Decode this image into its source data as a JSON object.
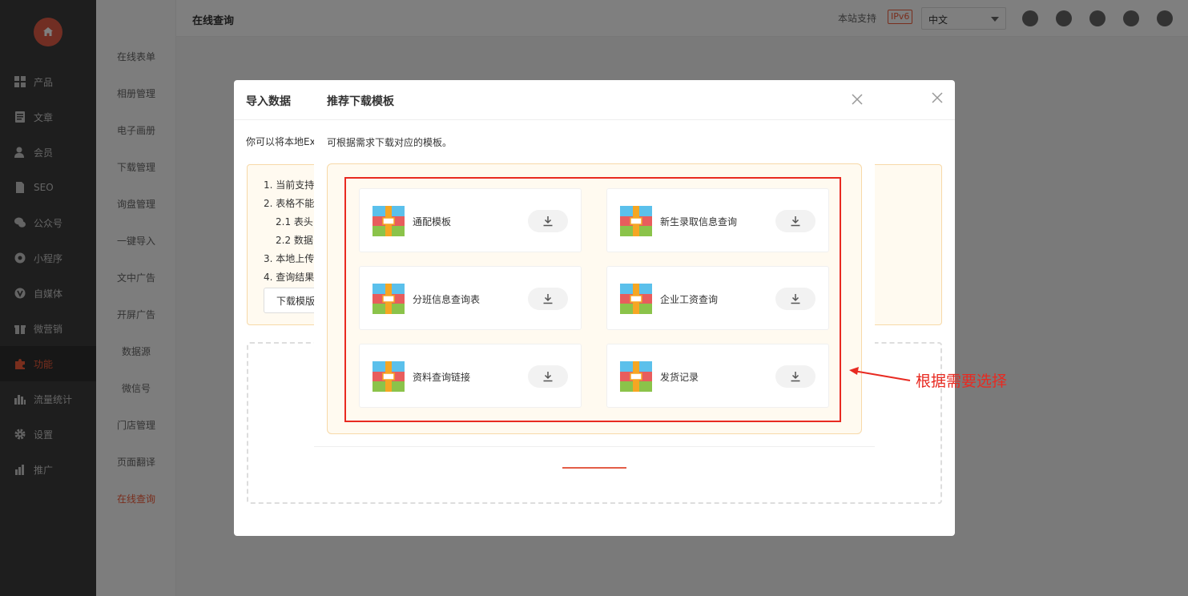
{
  "sidebar": {
    "items": [
      {
        "label": "产品",
        "icon": "grid-icon"
      },
      {
        "label": "文章",
        "icon": "document-icon"
      },
      {
        "label": "会员",
        "icon": "user-icon"
      },
      {
        "label": "SEO",
        "icon": "file-icon"
      },
      {
        "label": "公众号",
        "icon": "wechat-icon"
      },
      {
        "label": "小程序",
        "icon": "mini-program-icon"
      },
      {
        "label": "自媒体",
        "icon": "media-icon"
      },
      {
        "label": "微营销",
        "icon": "gift-icon"
      },
      {
        "label": "功能",
        "icon": "puzzle-icon",
        "active": true
      },
      {
        "label": "流量统计",
        "icon": "bar-chart-icon"
      },
      {
        "label": "设置",
        "icon": "gear-icon"
      },
      {
        "label": "推广",
        "icon": "promotion-icon"
      }
    ]
  },
  "submenu": {
    "items": [
      "在线表单",
      "相册管理",
      "电子画册",
      "下载管理",
      "询盘管理",
      "一键导入",
      "文中广告",
      "开屏广告",
      "数据源",
      "微信号",
      "门店管理",
      "页面翻译",
      "在线查询"
    ],
    "active_index": 12
  },
  "header": {
    "title": "在线查询",
    "ipv6_text": "本站支持",
    "ipv6_badge": "IPv6",
    "language": "中文"
  },
  "import_dialog": {
    "title": "导入数据",
    "desc": "你可以将本地Ex",
    "tips": [
      "1. 当前支持",
      "2. 表格不能",
      "2.1 表头",
      "2.2 数据",
      "3. 本地上传",
      "4. 查询结果"
    ],
    "download_template_label": "下载模版"
  },
  "template_modal": {
    "title": "推荐下载模板",
    "desc": "可根据需求下载对应的模板。",
    "templates": [
      "通配模板",
      "新生录取信息查询",
      "分班信息查询表",
      "企业工资查询",
      "资料查询链接",
      "发货记录"
    ]
  },
  "annotation": {
    "text": "根据需要选择",
    "color": "#e82a21"
  },
  "colors": {
    "accent": "#f25c3a",
    "sidebar_bg": "#3d3d3d"
  }
}
